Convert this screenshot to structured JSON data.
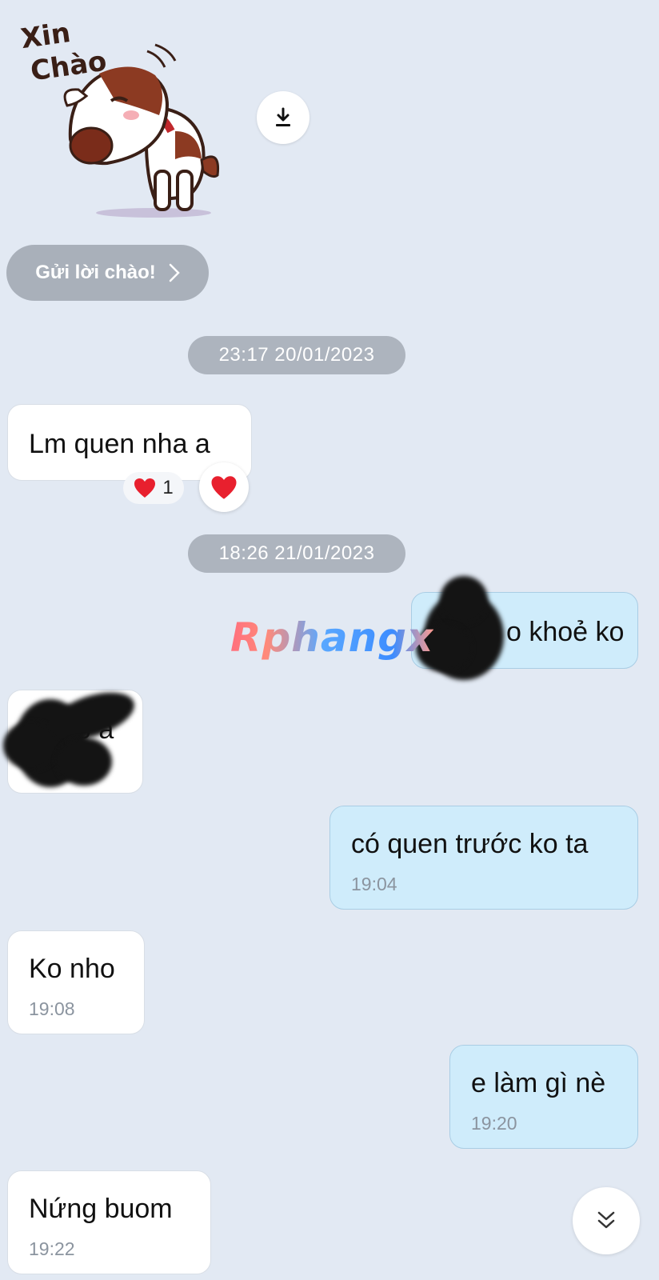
{
  "sticker": {
    "text_line1": "Xin",
    "text_line2": "Chào",
    "icon": "bowing-dog-sticker"
  },
  "download_icon": "download-icon",
  "greeting_button": {
    "label": "Gửi lời chào!",
    "icon": "chevron-right-icon"
  },
  "timestamps": [
    "23:17 20/01/2023",
    "18:26 21/01/2023"
  ],
  "messages": [
    {
      "side": "incoming",
      "text": "Lm quen nha a"
    },
    {
      "side": "outgoing",
      "text": "o khoẻ ko"
    },
    {
      "side": "incoming",
      "text": "o a"
    },
    {
      "side": "outgoing",
      "text": "có quen trước ko ta",
      "time": "19:04"
    },
    {
      "side": "incoming",
      "text": "Ko nho",
      "time": "19:08"
    },
    {
      "side": "outgoing",
      "text": "e làm gì nè",
      "time": "19:20"
    },
    {
      "side": "incoming",
      "text": "Nứng buom",
      "time": "19:22"
    }
  ],
  "reaction": {
    "emoji": "❤️",
    "count": "1",
    "icon": "heart-icon"
  },
  "watermark": "Rphangx",
  "scroll_button": {
    "icon": "double-chevron-down-icon"
  },
  "colors": {
    "background": "#e2e9f3",
    "incoming_bubble": "#ffffff",
    "outgoing_bubble": "#cfecfb",
    "timestamp_pill": "#adb4be",
    "heart": "#e8202e"
  }
}
